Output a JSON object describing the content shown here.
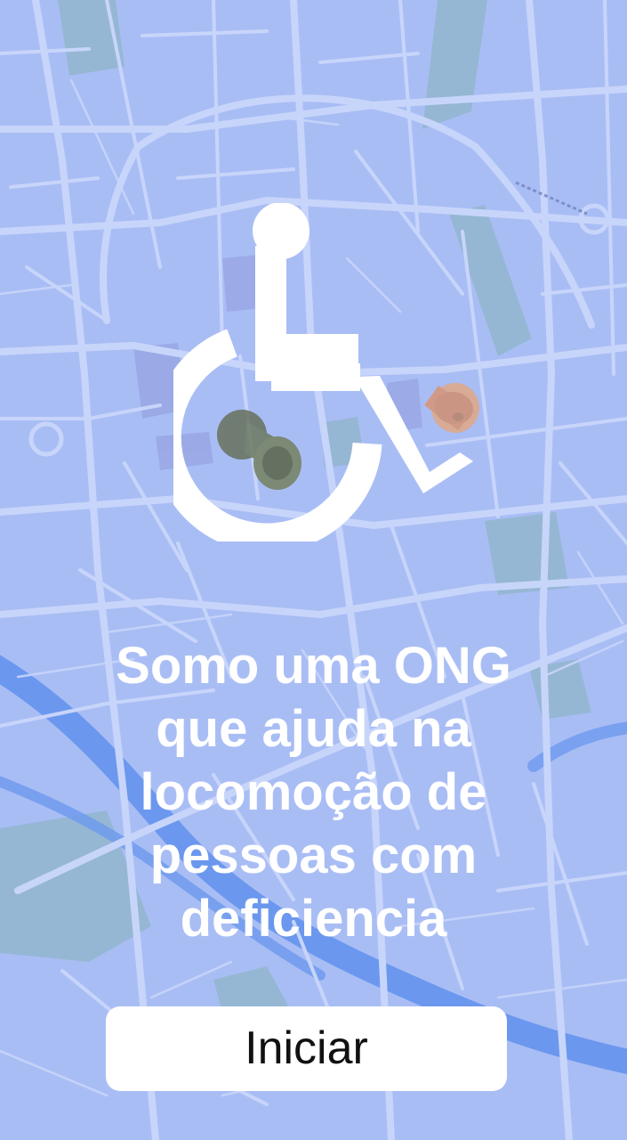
{
  "screen": {
    "background_color": "#a9bdf5",
    "map_street_color": "#c8d5fa",
    "map_park_color": "#8fb6c8",
    "map_river_color": "#6b98ee",
    "map_square_color": "#98a6e4"
  },
  "hero": {
    "icon": "wheelchair-accessibility-icon",
    "pins": [
      "dark-pushpin-icon",
      "pink-pushpin-icon"
    ]
  },
  "intro": {
    "text": "Somo uma ONG\nque ajuda na\nlocomoção de\npessoas com\ndeficiencia"
  },
  "actions": {
    "start_label": "Iniciar"
  }
}
